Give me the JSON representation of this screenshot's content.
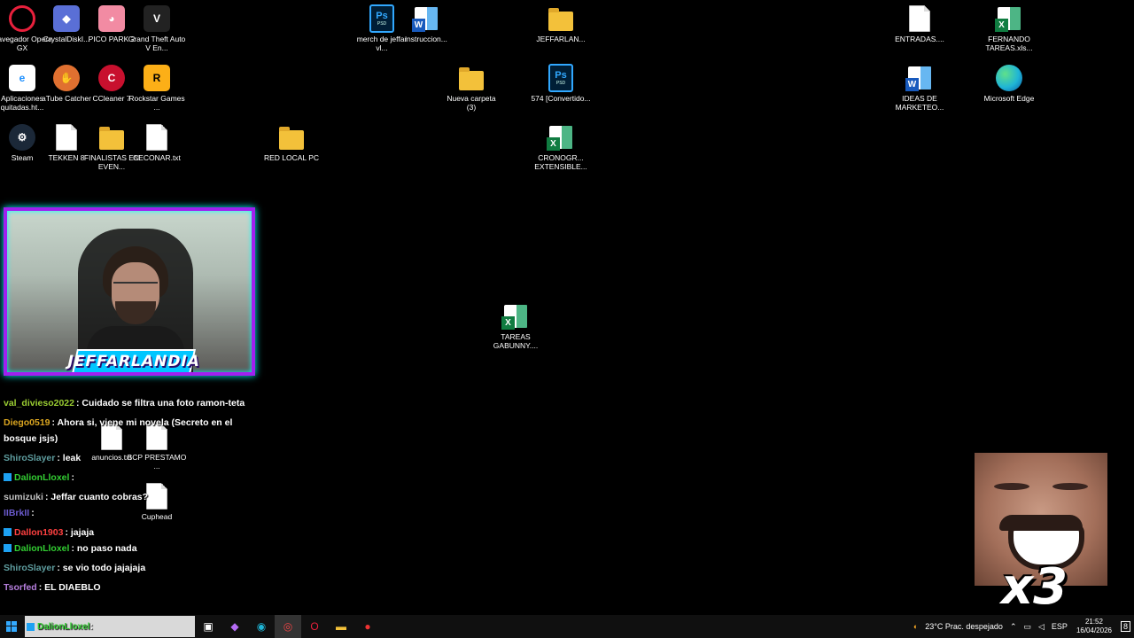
{
  "desktop_icons": [
    {
      "label": "Navegador Opera GX",
      "icon": "opera-gx-icon"
    },
    {
      "label": "CrystalDiskI...",
      "icon": "crystaldisk-icon"
    },
    {
      "label": "PICO PARK 2",
      "icon": "pico-park-icon"
    },
    {
      "label": "Grand Theft Auto V En...",
      "icon": "gta-icon"
    },
    {
      "label": "merch de jeffar vl...",
      "icon": "psd-icon"
    },
    {
      "label": "instruccion...",
      "icon": "word-icon"
    },
    {
      "label": "JEFFARLAN...",
      "icon": "folder-icon"
    },
    {
      "label": "ENTRADAS....",
      "icon": "document-icon"
    },
    {
      "label": "FERNANDO TAREAS.xls...",
      "icon": "excel-icon"
    },
    {
      "label": "Aplicaciones quitadas.ht...",
      "icon": "ie-icon"
    },
    {
      "label": "aTube Catcher",
      "icon": "atube-icon"
    },
    {
      "label": "CCleaner 7",
      "icon": "ccleaner-icon"
    },
    {
      "label": "Rockstar Games ...",
      "icon": "rockstar-icon"
    },
    {
      "label": "Nueva carpeta (3)",
      "icon": "folder-icon"
    },
    {
      "label": "574 [Convertido...",
      "icon": "psd-icon"
    },
    {
      "label": "IDEAS DE MARKETEO...",
      "icon": "word-icon"
    },
    {
      "label": "Microsoft Edge",
      "icon": "edge-icon"
    },
    {
      "label": "Steam",
      "icon": "steam-icon"
    },
    {
      "label": "TEKKEN 8",
      "icon": "document-icon"
    },
    {
      "label": "FINALISTAS EN EVEN...",
      "icon": "folder-icon"
    },
    {
      "label": "CECONAR.txt",
      "icon": "document-icon"
    },
    {
      "label": "RED LOCAL PC",
      "icon": "folder-icon"
    },
    {
      "label": "CRONOGR... EXTENSIBLE...",
      "icon": "excel-icon"
    },
    {
      "label": "TAREAS GABUNNY....",
      "icon": "excel-icon"
    },
    {
      "label": "anuncios.txt",
      "icon": "document-icon"
    },
    {
      "label": "BCP PRESTAMO ...",
      "icon": "document-icon"
    },
    {
      "label": "Cuphead",
      "icon": "document-icon"
    }
  ],
  "stream": {
    "overlay_logo": "JEFFARLANDIA"
  },
  "chat": [
    {
      "user": "val_divieso2022",
      "color": "#9acd32",
      "text": ": Cuidado se filtra una foto ramon-teta"
    },
    {
      "user": "Diego0519",
      "color": "#daa520",
      "text": ": Ahora si, viene mi novela (Secreto en el bosque jsjs)"
    },
    {
      "user": "ShiroSlayer",
      "color": "#5f9ea0",
      "text": ": leak"
    },
    {
      "user": "DalionLloxel",
      "color": "#32cd32",
      "text": ":"
    },
    {
      "user": "sumizuki",
      "color": "#c0c0c0",
      "text": ": Jeffar cuanto cobras?"
    },
    {
      "user": "IIBrkII",
      "color": "#6a5acd",
      "text": ":"
    },
    {
      "user": "Dallon1903",
      "color": "#ff4040",
      "text": ": jajaja"
    },
    {
      "user": "DalionLloxel",
      "color": "#32cd32",
      "text": ": no paso nada"
    },
    {
      "user": "ShiroSlayer",
      "color": "#5f9ea0",
      "text": ": se vio todo jajajaja"
    },
    {
      "user": "Tsorfed",
      "color": "#b57edc",
      "text": ": EL DIAEBLO"
    },
    {
      "user": "DalionLloxel",
      "color": "#32cd32",
      "text": ":"
    }
  ],
  "meme_overlay": {
    "multiplier": "x3"
  },
  "taskbar": {
    "weather": "23°C  Prac. despejado",
    "language": "ESP",
    "time": "21:52",
    "date": "16/04/2026",
    "notifications": "8"
  }
}
